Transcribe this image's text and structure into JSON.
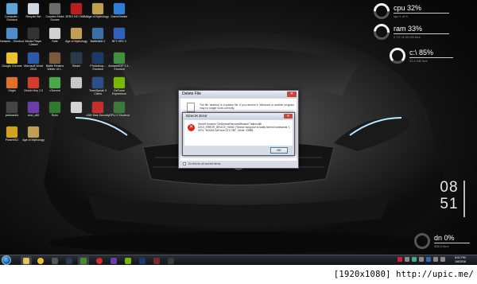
{
  "desktop": {
    "icons": [
      {
        "label": "Computer - Shortcut",
        "icon": "computer-icon",
        "color": "#5fa3d9"
      },
      {
        "label": "Recycle Bin",
        "icon": "recycle-bin-icon",
        "color": "#cfd8e0"
      },
      {
        "label": "Counter-Strike Source",
        "icon": "game-icon",
        "color": "#6b6b6b"
      },
      {
        "label": "ZERO NO YAIBA",
        "icon": "game-icon",
        "color": "#b81e1e"
      },
      {
        "label": "Age of Mythology",
        "icon": "game-icon",
        "color": "#c0a050"
      },
      {
        "label": "GameSeeker",
        "icon": "app-icon",
        "color": "#2e7dd6"
      },
      {
        "label": "Network - Shortcut",
        "icon": "network-icon",
        "color": "#4f8cc9"
      },
      {
        "label": "Media Player Classic",
        "icon": "media-player-icon",
        "color": "#333"
      },
      {
        "label": "Safe",
        "icon": "app-icon",
        "color": "#d0d0d0"
      },
      {
        "label": "Age of Mythology",
        "icon": "game-icon",
        "color": "#c0a050"
      },
      {
        "label": "Battlefield 2",
        "icon": "game-icon",
        "color": "#3a6fa8"
      },
      {
        "label": "BF2 SRV 2",
        "icon": "game-icon",
        "color": "#2f62c0"
      },
      {
        "label": "Google Chrome",
        "icon": "chrome-icon",
        "color": "#e9c230"
      },
      {
        "label": "Microsoft Word 2010",
        "icon": "word-icon",
        "color": "#2a5aa8"
      },
      {
        "label": "Battle Realms Winter of t...",
        "icon": "game-icon",
        "color": "#7a5a3a"
      },
      {
        "label": "Steam",
        "icon": "steam-icon",
        "color": "#2a3a4c"
      },
      {
        "label": "Photoshop - Shortcut",
        "icon": "photoshop-icon",
        "color": "#1a3a6a"
      },
      {
        "label": "AmazeMOP 2.4 - Shortcut",
        "icon": "app-icon",
        "color": "#3f8f3f"
      },
      {
        "label": "Origin",
        "icon": "origin-icon",
        "color": "#e0702a"
      },
      {
        "label": "Clicker Key 2.0",
        "icon": "app-icon",
        "color": "#d83b2b"
      },
      {
        "label": "uTorrent",
        "icon": "utorrent-icon",
        "color": "#4aa84a"
      },
      {
        "label": "",
        "icon": "app-icon",
        "color": "#c7c7c7"
      },
      {
        "label": "TeamSpeak 3 Client",
        "icon": "teamspeak-icon",
        "color": "#2b4f8c"
      },
      {
        "label": "GeForce Experience",
        "icon": "nvidia-icon",
        "color": "#76b900"
      },
      {
        "label": "jetclean64",
        "icon": "app-icon",
        "color": "#444"
      },
      {
        "label": "cmd_x86",
        "icon": "app-icon",
        "color": "#6a3ea8"
      },
      {
        "label": "Ruler",
        "icon": "app-icon",
        "color": "#2f7a2f"
      },
      {
        "label": "",
        "icon": "app-icon",
        "color": "#d4d4d4"
      },
      {
        "label": "USB Disk Security",
        "icon": "usb-icon",
        "color": "#c82e2e"
      },
      {
        "label": "GPU-Z Shortcut",
        "icon": "gpu-icon",
        "color": "#3a7a3a"
      },
      {
        "label": "PowerISO",
        "icon": "poweriso-icon",
        "color": "#d4a020"
      },
      {
        "label": "Age of Mythology",
        "icon": "game-icon",
        "color": "#c0a050"
      }
    ]
  },
  "gauges": {
    "cpu": {
      "label": "cpu 32%",
      "sub": "cpu 1 of 3"
    },
    "ram": {
      "label": "ram 33%",
      "sub": "2.74 / 8.33 GB free"
    },
    "disk": {
      "label": "c:\\ 85%",
      "sub": "22.9 GB free"
    }
  },
  "clock": {
    "hours": "08",
    "minutes": "51"
  },
  "net": {
    "label": "dn 0%",
    "sub": "306.0 kb/s"
  },
  "dialog_outer": {
    "title": "Delete File",
    "message": "The file 'desktop' is a system file. If you remove it, Windows or another program may no longer work correctly.",
    "checkbox_label": "Do this for all current items"
  },
  "dialog_inner": {
    "title": "DirectX Error",
    "message": "DirectX function \"GetDeviceRemovedReason\" failed with DXGI_ERROR_DEVICE_HUNG (\"Device hung due to badly formed commands.\"). GPU: \"NVIDIA GeForce GTX 780\", Driver: 33988",
    "ok_label": "OK"
  },
  "taskbar": {
    "clock_time": "8:51 PM",
    "clock_date": "1/8/2016"
  },
  "watermark": "[1920x1080] http://upic.me/",
  "colors": {
    "gauge_active": "#f2f2f2",
    "gauge_track": "#555555",
    "error_red": "#d6281f"
  }
}
